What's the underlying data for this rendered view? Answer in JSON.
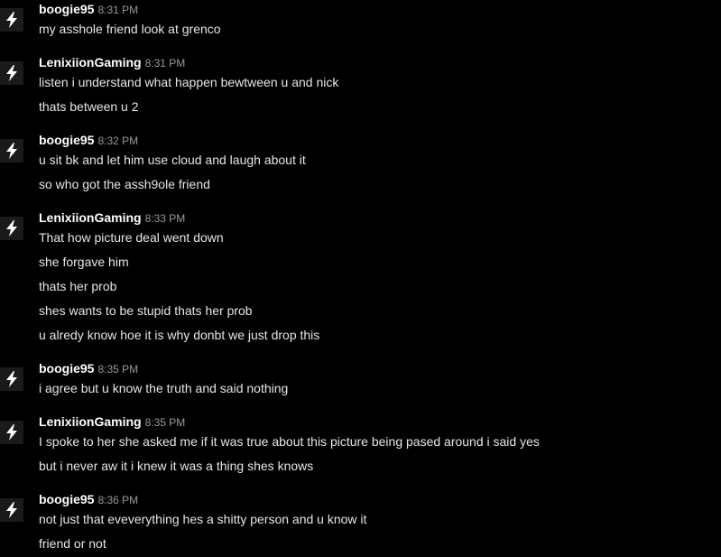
{
  "messages": [
    {
      "username": "boogie95",
      "time": "8:31 PM",
      "avatar_icon": "lightning-bolt-icon",
      "lines": [
        "my asshole friend look at grenco"
      ]
    },
    {
      "username": "LenixiionGaming",
      "time": "8:31 PM",
      "avatar_icon": "lightning-bolt-icon",
      "lines": [
        "listen i understand what happen bewtween u and nick",
        "thats between u 2"
      ]
    },
    {
      "username": "boogie95",
      "time": "8:32 PM",
      "avatar_icon": "lightning-bolt-icon",
      "lines": [
        "u sit bk and let him use cloud and laugh about it",
        "so who got the assh9ole friend"
      ]
    },
    {
      "username": "LenixiionGaming",
      "time": "8:33 PM",
      "avatar_icon": "lightning-bolt-icon",
      "lines": [
        "That how picture deal went down",
        "she forgave him",
        "thats her prob",
        "shes wants to be stupid thats her prob",
        "u alredy know hoe it is why donbt we just drop this"
      ]
    },
    {
      "username": "boogie95",
      "time": "8:35 PM",
      "avatar_icon": "lightning-bolt-icon",
      "lines": [
        "i agree but u know the truth and said nothing"
      ]
    },
    {
      "username": "LenixiionGaming",
      "time": "8:35 PM",
      "avatar_icon": "lightning-bolt-icon",
      "lines": [
        "I spoke to her she asked me if it was true about this picture being pased around i said yes",
        "but i never aw it i knew it was a thing shes knows"
      ]
    },
    {
      "username": "boogie95",
      "time": "8:36 PM",
      "avatar_icon": "lightning-bolt-icon",
      "lines": [
        "not just that eveverything hes a shitty person and u know it",
        "friend or not"
      ]
    }
  ]
}
